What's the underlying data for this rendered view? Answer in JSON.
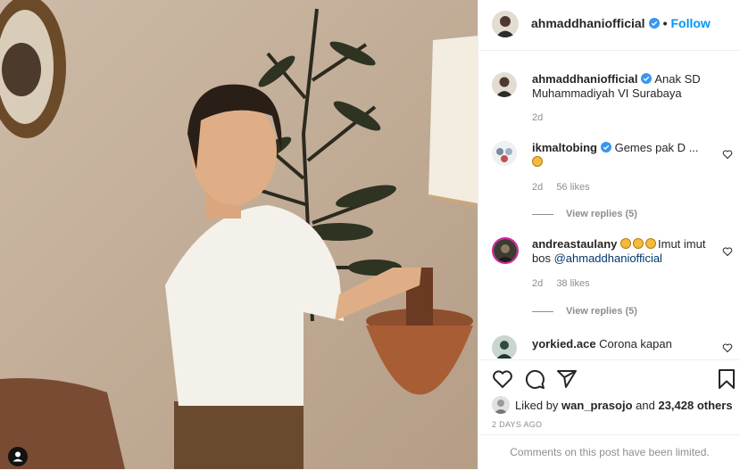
{
  "header": {
    "username": "ahmaddhaniofficial",
    "dot": "•",
    "follow_label": "Follow"
  },
  "caption": {
    "username": "ahmaddhaniofficial",
    "text": "Anak SD Muhammadiyah VI Surabaya",
    "age": "2d"
  },
  "comments": [
    {
      "username": "ikmaltobing",
      "text": "Gemes pak D",
      "more": "...",
      "age": "2d",
      "likes": "56 likes",
      "replies": "View replies (5)"
    },
    {
      "username": "andreastaulany",
      "text": "Imut imut bos ",
      "mention": "@ahmaddhaniofficial",
      "age": "2d",
      "likes": "38 likes",
      "replies": "View replies (5)"
    },
    {
      "username": "yorkied.ace",
      "text": "Corona kapan"
    }
  ],
  "likes": {
    "prefix": "Liked by ",
    "user": "wan_prasojo",
    "mid": " and ",
    "count": "23,428 others"
  },
  "date": "2 DAYS AGO",
  "comments_limited": "Comments on this post have been limited.",
  "colors": {
    "follow": "#0095f6",
    "verified": "#3897f0",
    "muted": "#8e8e8e"
  },
  "icons": [
    "verified-badge-icon",
    "heart-icon",
    "comment-icon",
    "share-icon",
    "bookmark-icon",
    "user-tag-icon"
  ]
}
